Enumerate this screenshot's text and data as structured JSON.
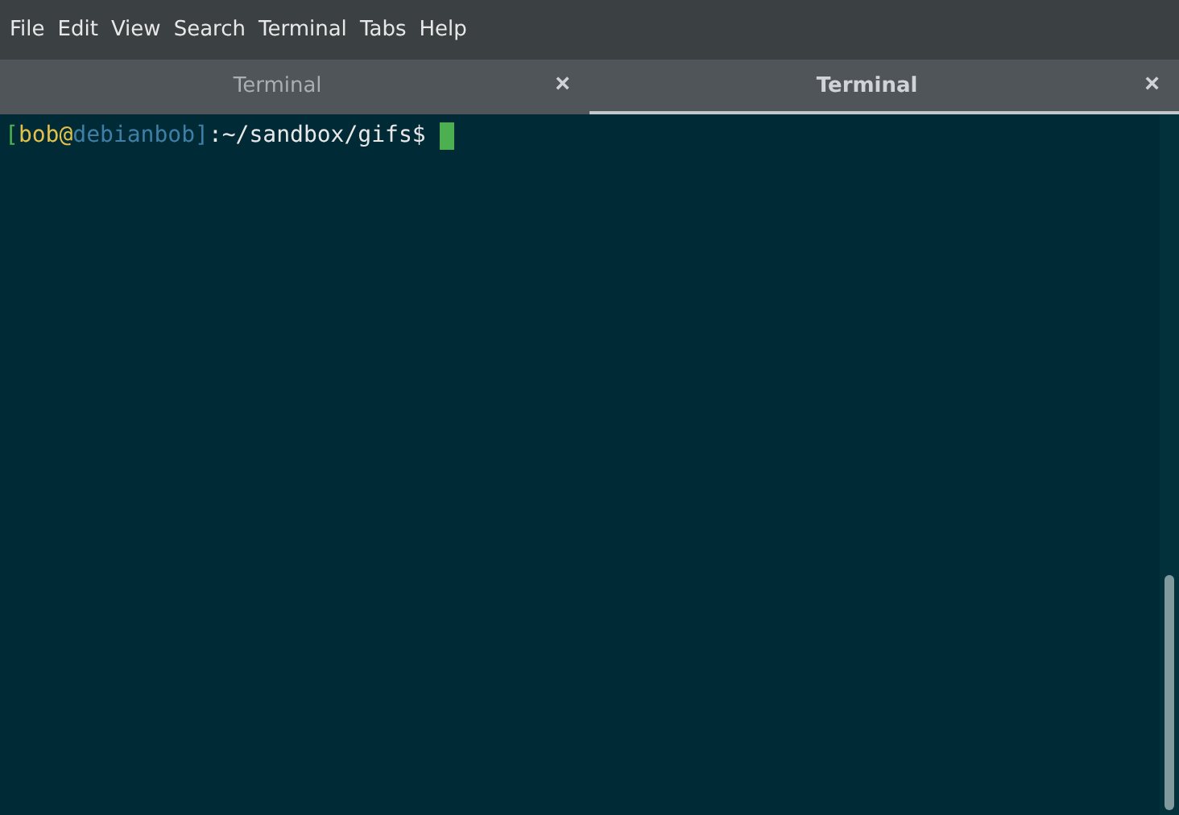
{
  "menu": [
    "File",
    "Edit",
    "View",
    "Search",
    "Terminal",
    "Tabs",
    "Help"
  ],
  "tabs": [
    {
      "label": "Terminal",
      "close": "×",
      "selected": false
    },
    {
      "label": "Terminal",
      "close": "×",
      "selected": true
    }
  ],
  "terminal": {
    "prompt": [
      {
        "text": "[",
        "color": "#4caf50"
      },
      {
        "text": "bob@",
        "color": "#e3c04a"
      },
      {
        "text": "debianbob",
        "color": "#3f7fa6"
      },
      {
        "text": "]",
        "color": "#3f7fa6"
      },
      {
        "text": ":~/sandbox/gifs$",
        "color": "#e8e8e8"
      }
    ]
  }
}
